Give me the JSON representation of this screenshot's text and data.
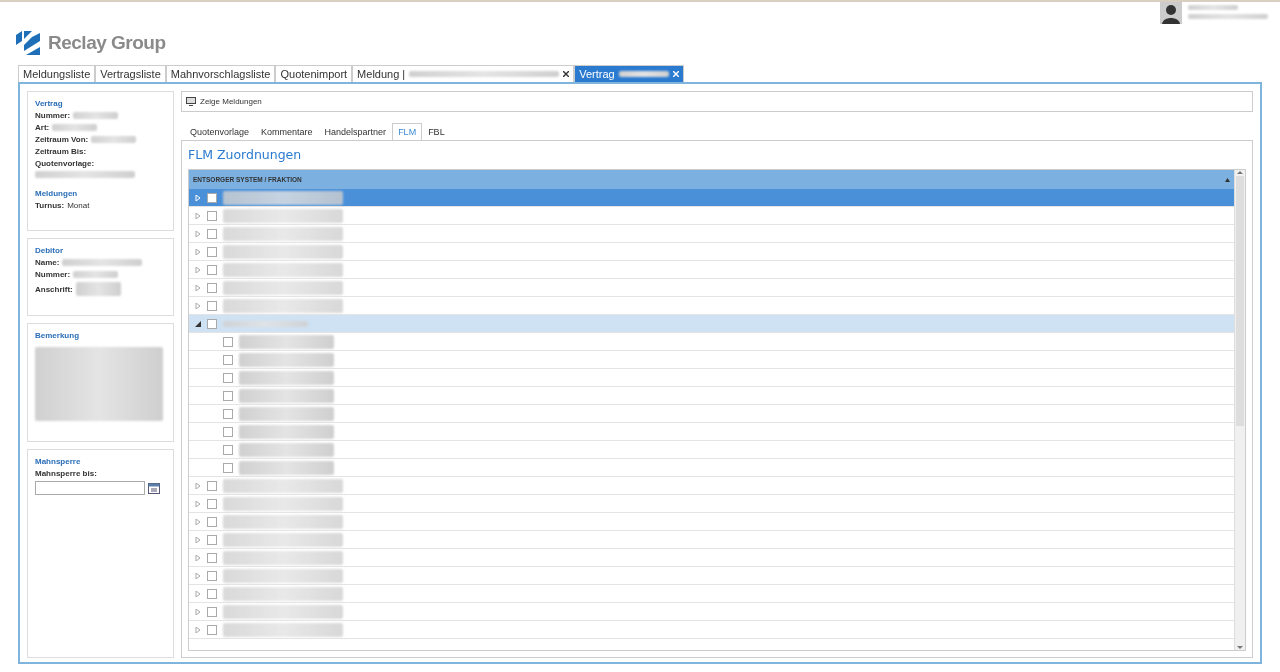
{
  "logo": {
    "text": "Reclay Group"
  },
  "tabs": [
    {
      "label": "Meldungsliste",
      "selected": false,
      "closable": false,
      "blurred": false
    },
    {
      "label": "Vertragsliste",
      "selected": false,
      "closable": false,
      "blurred": false
    },
    {
      "label": "Mahnvorschlagsliste",
      "selected": false,
      "closable": false,
      "blurred": false
    },
    {
      "label": "Quotenimport",
      "selected": false,
      "closable": false,
      "blurred": false
    },
    {
      "label": "Meldung |",
      "selected": false,
      "closable": true,
      "blurred": true
    },
    {
      "label": "Vertrag",
      "selected": true,
      "closable": true,
      "blurred": true
    }
  ],
  "sidebar": {
    "panels": [
      {
        "title": "Vertrag",
        "fields": [
          {
            "label": "Nummer:"
          },
          {
            "label": "Art:"
          },
          {
            "label": "Zeitraum Von:"
          },
          {
            "label": "Zeitraum Bis:"
          },
          {
            "label": "Quotenvorlage:"
          }
        ],
        "subtitle": "Meldungen",
        "subfields": [
          {
            "label": "Turnus:",
            "value": "Monat"
          }
        ]
      },
      {
        "title": "Debitor",
        "fields": [
          {
            "label": "Name:"
          },
          {
            "label": "Nummer:"
          },
          {
            "label": "Anschrift:"
          }
        ]
      },
      {
        "title": "Bemerkung"
      },
      {
        "title": "Mahnsperre",
        "date_field": {
          "label": "Mahnsperre bis:"
        }
      }
    ]
  },
  "toolbar": {
    "button": "Zeige Meldungen"
  },
  "subtabs": [
    {
      "label": "Quotenvorlage",
      "selected": false
    },
    {
      "label": "Kommentare",
      "selected": false
    },
    {
      "label": "Handelspartner",
      "selected": false
    },
    {
      "label": "FLM",
      "selected": true
    },
    {
      "label": "FBL",
      "selected": false
    }
  ],
  "section_title": "FLM Zuordnungen",
  "tree": {
    "column": "ENTSORGER SYSTEM / FRAKTION",
    "rows": [
      {
        "selected": true,
        "expanded": false,
        "checked": false
      },
      {
        "selected": false,
        "expanded": false,
        "checked": false
      },
      {
        "selected": false,
        "expanded": false,
        "checked": false
      },
      {
        "selected": false,
        "expanded": false,
        "checked": false
      },
      {
        "selected": false,
        "expanded": false,
        "checked": false
      },
      {
        "selected": false,
        "expanded": false,
        "checked": false
      },
      {
        "selected": false,
        "expanded": false,
        "checked": false
      },
      {
        "selected": false,
        "expanded": true,
        "checked": false,
        "children": [
          {
            "checked": false
          },
          {
            "checked": false
          },
          {
            "checked": false
          },
          {
            "checked": false
          },
          {
            "checked": false
          },
          {
            "checked": false
          },
          {
            "checked": false
          },
          {
            "checked": false
          }
        ]
      },
      {
        "selected": false,
        "expanded": false,
        "checked": false
      },
      {
        "selected": false,
        "expanded": false,
        "checked": false
      },
      {
        "selected": false,
        "expanded": false,
        "checked": false
      },
      {
        "selected": false,
        "expanded": false,
        "checked": false
      },
      {
        "selected": false,
        "expanded": false,
        "checked": false
      },
      {
        "selected": false,
        "expanded": false,
        "checked": false
      },
      {
        "selected": false,
        "expanded": false,
        "checked": false
      },
      {
        "selected": false,
        "expanded": false,
        "checked": false
      },
      {
        "selected": false,
        "expanded": false,
        "checked": false
      }
    ]
  }
}
